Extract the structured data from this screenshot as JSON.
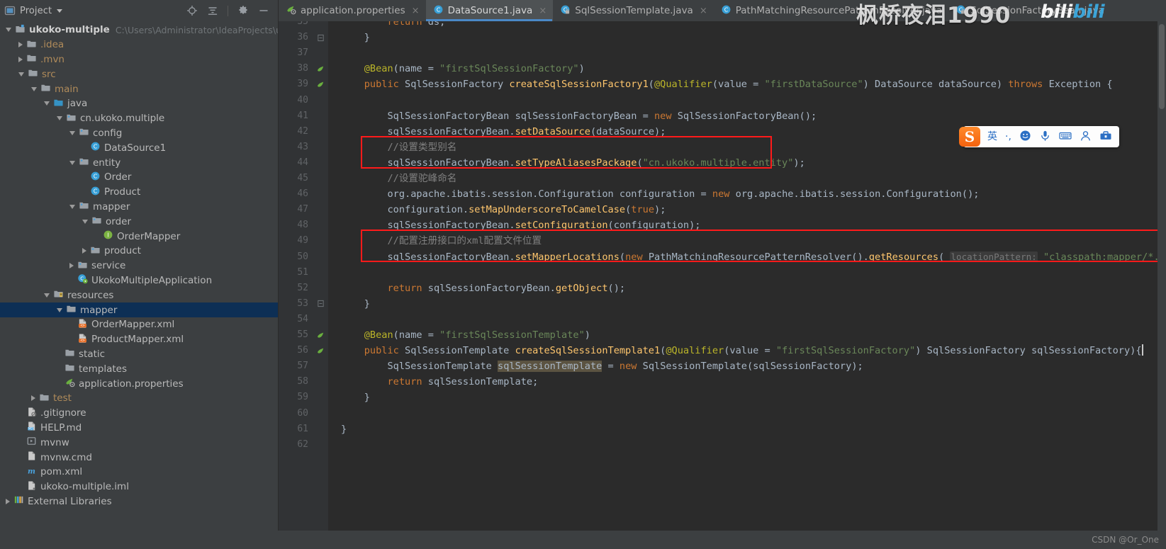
{
  "toolwindow": {
    "title": "Project",
    "icons": [
      "project-icon",
      "chevron-down-icon",
      "locate-icon",
      "collapse-all-icon",
      "settings-gear-icon",
      "hide-icon"
    ]
  },
  "tree": {
    "root": {
      "label": "ukoko-multiple",
      "path": "C:\\Users\\Administrator\\IdeaProjects\\uko"
    },
    "items": [
      {
        "label": ".idea",
        "indent": 1,
        "state": "closed",
        "icon": "folder-icon"
      },
      {
        "label": ".mvn",
        "indent": 1,
        "state": "closed",
        "icon": "folder-icon"
      },
      {
        "label": "src",
        "indent": 1,
        "state": "open",
        "icon": "folder-icon"
      },
      {
        "label": "main",
        "indent": 2,
        "state": "open",
        "icon": "folder-icon"
      },
      {
        "label": "java",
        "indent": 3,
        "state": "open",
        "icon": "source-root-icon"
      },
      {
        "label": "cn.ukoko.multiple",
        "indent": 4,
        "state": "open",
        "icon": "package-icon"
      },
      {
        "label": "config",
        "indent": 5,
        "state": "open",
        "icon": "package-icon"
      },
      {
        "label": "DataSource1",
        "indent": 6,
        "state": "leaf",
        "icon": "java-class-icon"
      },
      {
        "label": "entity",
        "indent": 5,
        "state": "open",
        "icon": "package-icon"
      },
      {
        "label": "Order",
        "indent": 6,
        "state": "leaf",
        "icon": "java-class-icon"
      },
      {
        "label": "Product",
        "indent": 6,
        "state": "leaf",
        "icon": "java-class-icon"
      },
      {
        "label": "mapper",
        "indent": 5,
        "state": "open",
        "icon": "package-icon"
      },
      {
        "label": "order",
        "indent": 6,
        "state": "open",
        "icon": "package-icon"
      },
      {
        "label": "OrderMapper",
        "indent": 7,
        "state": "leaf",
        "icon": "java-interface-icon"
      },
      {
        "label": "product",
        "indent": 6,
        "state": "closed",
        "icon": "package-icon"
      },
      {
        "label": "service",
        "indent": 5,
        "state": "closed",
        "icon": "package-icon"
      },
      {
        "label": "UkokoMultipleApplication",
        "indent": 5,
        "state": "leaf",
        "icon": "spring-boot-class-icon"
      },
      {
        "label": "resources",
        "indent": 3,
        "state": "open",
        "icon": "resource-root-icon"
      },
      {
        "label": "mapper",
        "indent": 4,
        "state": "open",
        "icon": "folder-icon",
        "selected": true
      },
      {
        "label": "OrderMapper.xml",
        "indent": 5,
        "state": "leaf",
        "icon": "xml-file-icon"
      },
      {
        "label": "ProductMapper.xml",
        "indent": 5,
        "state": "leaf",
        "icon": "xml-file-icon"
      },
      {
        "label": "static",
        "indent": 4,
        "state": "leaf",
        "icon": "folder-icon"
      },
      {
        "label": "templates",
        "indent": 4,
        "state": "leaf",
        "icon": "folder-icon"
      },
      {
        "label": "application.properties",
        "indent": 4,
        "state": "leaf",
        "icon": "spring-properties-icon"
      },
      {
        "label": "test",
        "indent": 2,
        "state": "closed",
        "icon": "folder-icon"
      },
      {
        "label": ".gitignore",
        "indent": 1,
        "state": "leaf",
        "icon": "gitignore-file-icon"
      },
      {
        "label": "HELP.md",
        "indent": 1,
        "state": "leaf",
        "icon": "markdown-file-icon"
      },
      {
        "label": "mvnw",
        "indent": 1,
        "state": "leaf",
        "icon": "script-file-icon"
      },
      {
        "label": "mvnw.cmd",
        "indent": 1,
        "state": "leaf",
        "icon": "cmd-file-icon"
      },
      {
        "label": "pom.xml",
        "indent": 1,
        "state": "leaf",
        "icon": "maven-file-icon"
      },
      {
        "label": "ukoko-multiple.iml",
        "indent": 1,
        "state": "leaf",
        "icon": "iml-file-icon"
      },
      {
        "label": "External Libraries",
        "indent": 0,
        "state": "closed",
        "icon": "libraries-icon"
      }
    ]
  },
  "tabs": [
    {
      "label": "application.properties",
      "icon": "spring-properties-icon",
      "active": false,
      "closable": true
    },
    {
      "label": "DataSource1.java",
      "icon": "java-class-icon",
      "active": true,
      "closable": true
    },
    {
      "label": "SqlSessionTemplate.java",
      "icon": "java-class-readonly-icon",
      "active": false,
      "closable": true
    },
    {
      "label": "PathMatchingResourcePatternResolver.java",
      "icon": "java-class-icon",
      "active": false,
      "closable": false
    },
    {
      "label": "SqlSessionFactoryBean.java",
      "icon": "java-class-readonly-icon",
      "active": false,
      "closable": false
    }
  ],
  "editor": {
    "first_line_number": 35,
    "lines": [
      {
        "n": 35,
        "text": "        return ds;",
        "cut": true
      },
      {
        "n": 36,
        "text": "    }",
        "fold": "end"
      },
      {
        "n": 37,
        "text": ""
      },
      {
        "n": 38,
        "text": "    @Bean(name = \"firstSqlSessionFactory\")",
        "gutter": "bean-icon"
      },
      {
        "n": 39,
        "text": "    public SqlSessionFactory createSqlSessionFactory1(@Qualifier(value = \"firstDataSource\") DataSource dataSource) throws Exception {",
        "gutter": "bean-run-icon",
        "fold": "start"
      },
      {
        "n": 40,
        "text": ""
      },
      {
        "n": 41,
        "text": "        SqlSessionFactoryBean sqlSessionFactoryBean = new SqlSessionFactoryBean();"
      },
      {
        "n": 42,
        "text": "        sqlSessionFactoryBean.setDataSource(dataSource);"
      },
      {
        "n": 43,
        "text": "        //设置类型别名"
      },
      {
        "n": 44,
        "text": "        sqlSessionFactoryBean.setTypeAliasesPackage(\"cn.ukoko.multiple.entity\");"
      },
      {
        "n": 45,
        "text": "        //设置驼峰命名"
      },
      {
        "n": 46,
        "text": "        org.apache.ibatis.session.Configuration configuration = new org.apache.ibatis.session.Configuration();"
      },
      {
        "n": 47,
        "text": "        configuration.setMapUnderscoreToCamelCase(true);"
      },
      {
        "n": 48,
        "text": "        sqlSessionFactoryBean.setConfiguration(configuration);"
      },
      {
        "n": 49,
        "text": "        //配置注册接口的xml配置文件位置"
      },
      {
        "n": 50,
        "text": "        sqlSessionFactoryBean.setMapperLocations(new PathMatchingResourcePatternResolver().getResources( locationPattern: \"classpath:mapper/*.xml\"))"
      },
      {
        "n": 51,
        "text": ""
      },
      {
        "n": 52,
        "text": "        return sqlSessionFactoryBean.getObject();"
      },
      {
        "n": 53,
        "text": "    }",
        "fold": "end"
      },
      {
        "n": 54,
        "text": ""
      },
      {
        "n": 55,
        "text": "    @Bean(name = \"firstSqlSessionTemplate\")",
        "gutter": "bean-icon"
      },
      {
        "n": 56,
        "text": "    public SqlSessionTemplate createSqlSessionTemplate1(@Qualifier(value = \"firstSqlSessionFactory\") SqlSessionFactory sqlSessionFactory){",
        "gutter": "bean-run-icon"
      },
      {
        "n": 57,
        "text": "        SqlSessionTemplate sqlSessionTemplate = new SqlSessionTemplate(sqlSessionFactory);"
      },
      {
        "n": 58,
        "text": "        return sqlSessionTemplate;"
      },
      {
        "n": 59,
        "text": "    }"
      },
      {
        "n": 60,
        "text": ""
      },
      {
        "n": 61,
        "text": "}"
      },
      {
        "n": 62,
        "text": ""
      }
    ],
    "parameter_hint": "locationPattern:",
    "highlighted_identifier": "sqlSessionTemplate",
    "annotation_boxes": 2,
    "annotation_color": "#ff1a1a"
  },
  "ime": {
    "logo": "S",
    "items": [
      "英",
      "·,",
      "smiley-icon",
      "microphone-icon",
      "keyboard-icon",
      "user-icon",
      "toolbox-icon"
    ]
  },
  "watermarks": {
    "top": "枫桥夜泪1990",
    "brand_a": "bili",
    "brand_b": "bili",
    "bottom_right": "CSDN @Or_One"
  }
}
